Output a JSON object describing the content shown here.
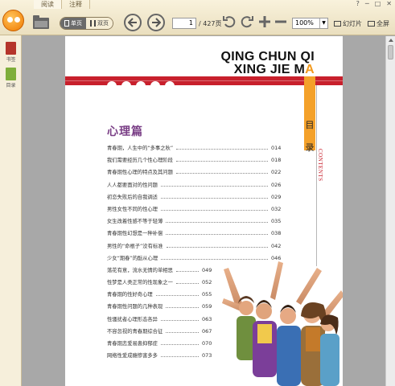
{
  "window": {
    "tabs": [
      "阅读",
      "注释"
    ],
    "controls": [
      "?",
      "─",
      "□",
      "✕"
    ]
  },
  "toolbar": {
    "view_single": "单页",
    "view_double": "双页",
    "current_page": "1",
    "total_pages": "/ 427页",
    "zoom": "100%",
    "slideshow_label": "幻灯片",
    "fullscreen_label": "全屏"
  },
  "sidebar": {
    "items": [
      {
        "label": "书签",
        "icon": "bookmark-icon"
      },
      {
        "label": "目录",
        "icon": "toc-icon"
      }
    ]
  },
  "colors": {
    "accent_red": "#c8202c",
    "accent_orange": "#f4a12a",
    "section_purple": "#7a3f86"
  },
  "document": {
    "title_line1": "QING CHUN QI",
    "title_line2_main": "XING JIE M",
    "title_line2_accent": "A",
    "mulu": [
      "目",
      "录"
    ],
    "contents": "CONTENTS",
    "section_title": "心理篇",
    "toc": [
      {
        "title": "青春期，人生中的“多事之秋”",
        "page": "014"
      },
      {
        "title": "我们需要经历几个性心理阶段",
        "page": "018"
      },
      {
        "title": "青春期性心理的特点及其问题",
        "page": "022"
      },
      {
        "title": "人人都要面对的性问题",
        "page": "026"
      },
      {
        "title": "初恋失败后的自我调适",
        "page": "029"
      },
      {
        "title": "男性女性不同的性心理",
        "page": "032"
      },
      {
        "title": "女生改着性感不等于轻薄",
        "page": "035"
      },
      {
        "title": "青春期性幻想是一种补偿",
        "page": "038"
      },
      {
        "title": "男性的“命根子”没有标准",
        "page": "042"
      },
      {
        "title": "少女“期春”的酝从心理",
        "page": "046"
      },
      {
        "title": "落花有意，流水无情的单相思",
        "page": "049"
      },
      {
        "title": "性梦是人类正常的性现象之一",
        "page": "052"
      },
      {
        "title": "青春期的性好奇心理",
        "page": "055"
      },
      {
        "title": "青春期性问题的几种表现",
        "page": "059"
      },
      {
        "title": "性骚扰者心理形态各异",
        "page": "063"
      },
      {
        "title": "不容忽视的青春期综合征",
        "page": "067"
      },
      {
        "title": "青春期恋爱易患抑郁症",
        "page": "070"
      },
      {
        "title": "网络性爱成瘾惨害多多",
        "page": "073"
      }
    ]
  }
}
